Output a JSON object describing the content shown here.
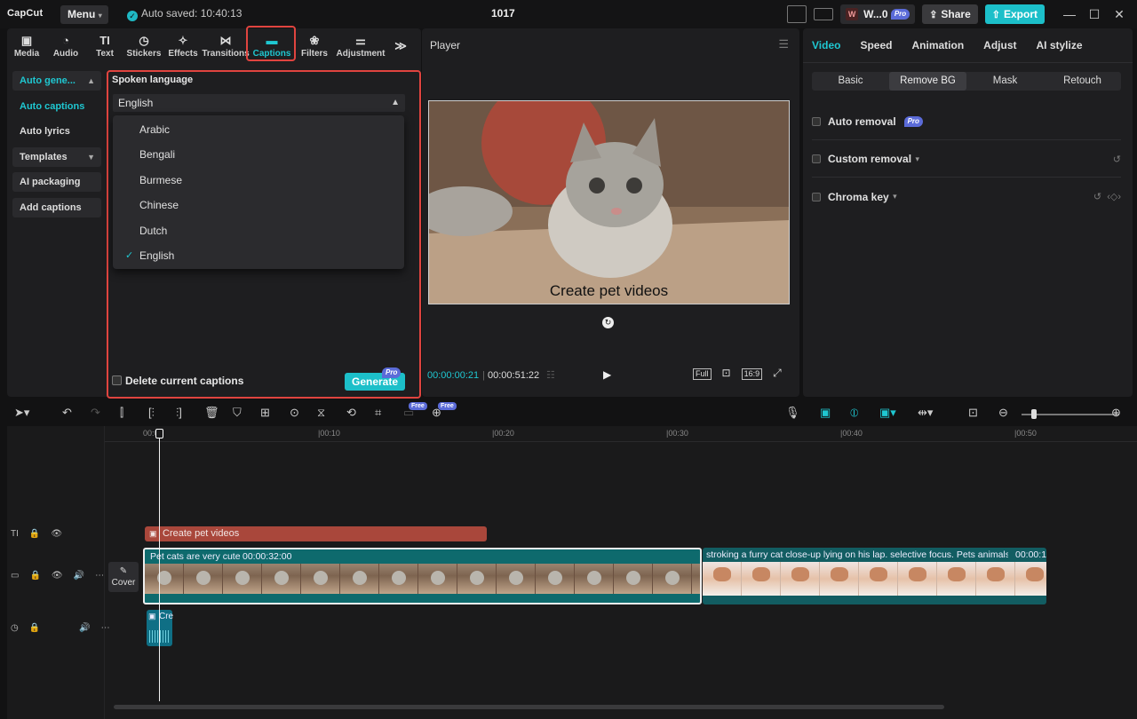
{
  "titlebar": {
    "logo": "CapCut",
    "menu_label": "Menu",
    "autosave": "Auto saved: 10:40:13",
    "project_name": "1017",
    "workspace_name": "W...0",
    "pro_badge": "Pro",
    "share_label": "Share",
    "export_label": "Export"
  },
  "tool_tabs": [
    {
      "label": "Media",
      "icon": "media-icon"
    },
    {
      "label": "Audio",
      "icon": "audio-icon"
    },
    {
      "label": "Text",
      "icon": "text-icon"
    },
    {
      "label": "Stickers",
      "icon": "stickers-icon"
    },
    {
      "label": "Effects",
      "icon": "effects-icon"
    },
    {
      "label": "Transitions",
      "icon": "transitions-icon"
    },
    {
      "label": "Captions",
      "icon": "captions-icon",
      "active": true
    },
    {
      "label": "Filters",
      "icon": "filters-icon"
    },
    {
      "label": "Adjustment",
      "icon": "adjustment-icon"
    }
  ],
  "subnav": {
    "items": [
      "Auto gene...",
      "Auto captions",
      "Auto lyrics",
      "Templates",
      "AI packaging",
      "Add captions"
    ]
  },
  "captions_panel": {
    "spoken_language_label": "Spoken language",
    "selected_language": "English",
    "language_options": [
      "Arabic",
      "Bengali",
      "Burmese",
      "Chinese",
      "Dutch",
      "English"
    ],
    "delete_label": "Delete current captions",
    "generate_label": "Generate",
    "generate_badge": "Pro"
  },
  "player": {
    "title": "Player",
    "caption_overlay": "Create pet videos",
    "time_current": "00:00:00:21",
    "time_total": "00:00:51:22",
    "full_label": "Full",
    "ratio_label": "16:9"
  },
  "right_panel": {
    "tabs": [
      "Video",
      "Speed",
      "Animation",
      "Adjust",
      "AI stylize"
    ],
    "segments": [
      "Basic",
      "Remove BG",
      "Mask",
      "Retouch"
    ],
    "rows": [
      "Auto removal",
      "Custom removal",
      "Chroma key"
    ],
    "pro_badge": "Pro"
  },
  "toolbar": {
    "free_badge": "Free"
  },
  "timeline": {
    "ruler": [
      "00:00",
      "|00:10",
      "|00:20",
      "|00:30",
      "|00:40",
      "|00:50"
    ],
    "text_clip": "Create pet videos",
    "video_clip_label": "Pet cats are very cute",
    "video_clip_duration": "00:00:32:00",
    "video_clip2_label": "stroking a furry cat close-up lying on his lap. selective focus. Pets animals",
    "video_clip2_duration": "00:00:1",
    "cover_label": "Cover",
    "audio_clip_label": "Cre"
  },
  "colors": {
    "accent": "#1fc7d1",
    "highlight": "#e0443f",
    "text_clip": "#a9473b",
    "video_clip": "#0e6a6d"
  }
}
